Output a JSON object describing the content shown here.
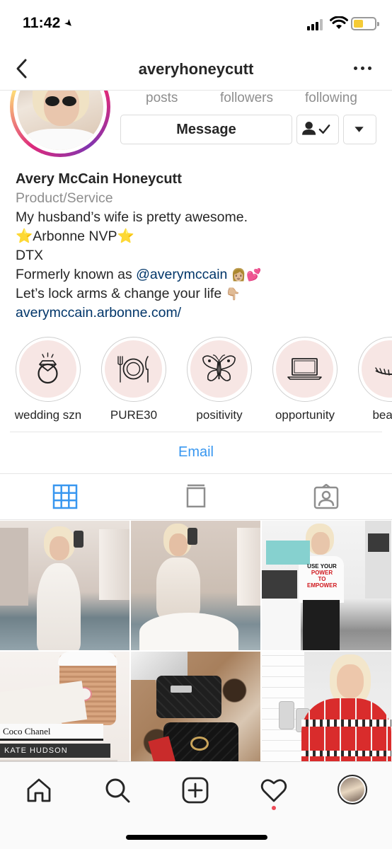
{
  "status_bar": {
    "time": "11:42"
  },
  "header": {
    "username": "averyhoneycutt"
  },
  "profile": {
    "stat_labels": [
      "posts",
      "followers",
      "following"
    ],
    "message_label": "Message"
  },
  "bio": {
    "name": "Avery McCain Honeycutt",
    "category": "Product/Service",
    "line1": "My husband’s wife is pretty awesome.",
    "line2_star": "⭐",
    "line2_text": "Arbonne NVP",
    "line3": "DTX",
    "line4_text": "Formerly known as",
    "line4_mention": "@averymccain",
    "line5": "Let’s lock arms & change your life",
    "link": "averymccain.arbonne.com/"
  },
  "highlights": [
    {
      "label": "wedding szn",
      "icon": "ring-icon"
    },
    {
      "label": "PURE30",
      "icon": "plate-icon"
    },
    {
      "label": "positivity",
      "icon": "butterfly-icon"
    },
    {
      "label": "opportunity",
      "icon": "laptop-icon"
    },
    {
      "label": "beauty",
      "icon": "eyelash-icon"
    }
  ],
  "contact": {
    "email_label": "Email"
  },
  "tabs": [
    "grid-icon",
    "igtv-icon",
    "tagged-icon"
  ],
  "posts": [
    {
      "icon": "photo-wedding-gown-1"
    },
    {
      "icon": "photo-wedding-gown-2"
    },
    {
      "icon": "photo-power-shirt"
    },
    {
      "icon": "photo-coffee-books"
    },
    {
      "icon": "photo-handbags-leopard"
    },
    {
      "icon": "photo-holiday-sweater"
    }
  ],
  "post_texts": {
    "shirt_line1": "USE YOUR",
    "shirt_line2": "POWER TO",
    "shirt_line3": "EMPOWER",
    "book1": "Coco Chanel",
    "book2": "KATE HUDSON"
  },
  "colors": {
    "link": "#003569",
    "email": "#3897f0",
    "tab_active": "#3897f0",
    "notification_dot": "#ed4956"
  }
}
